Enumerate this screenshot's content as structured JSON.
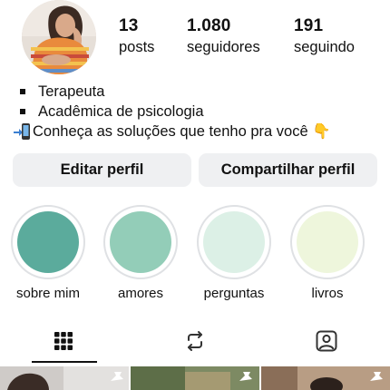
{
  "profile": {
    "stats": [
      {
        "value": "13",
        "label": "posts"
      },
      {
        "value": "1.080",
        "label": "seguidores"
      },
      {
        "value": "191",
        "label": "seguindo"
      }
    ],
    "bio": {
      "line1": "Terapeuta",
      "line2": "Acadêmica de psicologia",
      "line3": "Conheça as soluções que tenho pra você 👇"
    }
  },
  "actions": {
    "edit_label": "Editar perfil",
    "share_label": "Compartilhar perfil"
  },
  "highlights": [
    {
      "label": "sobre mim",
      "color": "#5bab9c"
    },
    {
      "label": "amores",
      "color": "#93cdb8"
    },
    {
      "label": "perguntas",
      "color": "#dcf0e6"
    },
    {
      "label": "livros",
      "color": "#eef6dc"
    }
  ],
  "tabs": {
    "icons": [
      "grid-icon",
      "reels-icon",
      "tagged-icon"
    ],
    "active": 0
  }
}
